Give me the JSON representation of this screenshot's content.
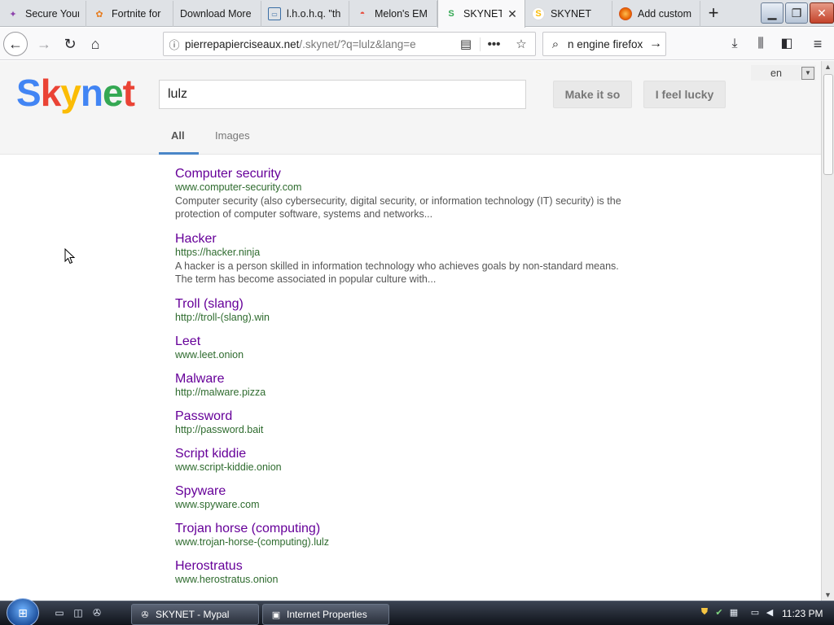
{
  "browser": {
    "tabs": [
      {
        "title": "Secure Your",
        "favicon": "star-icon",
        "favicon_color": "#8e44ad",
        "active": false
      },
      {
        "title": "Fortnite for",
        "favicon": "puzzle-icon",
        "favicon_color": "#e67e22",
        "active": false
      },
      {
        "title": "Download More",
        "favicon": "",
        "favicon_color": "",
        "active": false
      },
      {
        "title": "l.h.o.h.q. \"th",
        "favicon": "",
        "favicon_color": "",
        "active": false
      },
      {
        "title": "Melon's EM",
        "favicon": "watermelon-icon",
        "favicon_color": "#e74c3c",
        "active": false
      },
      {
        "title": "SKYNET",
        "favicon": "dollar-s-icon",
        "favicon_color": "#34a853",
        "active": true
      },
      {
        "title": "SKYNET",
        "favicon": "dollar-s-icon",
        "favicon_color": "#fbbc05",
        "active": false
      },
      {
        "title": "Add custom",
        "favicon": "firefox-icon",
        "favicon_color": "#e66000",
        "active": false
      }
    ],
    "url": {
      "host": "pierrepapierciseaux.net",
      "path": "/.skynet/?q=lulz&lang=e"
    },
    "search_text": "n engine firefox"
  },
  "page": {
    "logo": [
      "S",
      "k",
      "y",
      "n",
      "e",
      "t"
    ],
    "query": "lulz",
    "make_it_so": "Make it so",
    "feel_lucky": "I feel lucky",
    "lang": "en",
    "tabs": [
      "All",
      "Images"
    ],
    "results": [
      {
        "title": "Computer security",
        "url": "www.computer-security.com",
        "desc": "Computer security (also cybersecurity, digital security, or information technology (IT) security) is the protection of computer software, systems and networks..."
      },
      {
        "title": "Hacker",
        "url": "https://hacker.ninja",
        "desc": "A hacker is a person skilled in information technology who achieves goals by non-standard means. The term has become associated in popular culture with..."
      },
      {
        "title": "Troll (slang)",
        "url": "http://troll-(slang).win",
        "desc": ""
      },
      {
        "title": "Leet",
        "url": "www.leet.onion",
        "desc": ""
      },
      {
        "title": "Malware",
        "url": "http://malware.pizza",
        "desc": ""
      },
      {
        "title": "Password",
        "url": "http://password.bait",
        "desc": ""
      },
      {
        "title": "Script kiddie",
        "url": "www.script-kiddie.onion",
        "desc": ""
      },
      {
        "title": "Spyware",
        "url": "www.spyware.com",
        "desc": ""
      },
      {
        "title": "Trojan horse (computing)",
        "url": "www.trojan-horse-(computing).lulz",
        "desc": ""
      },
      {
        "title": "Herostratus",
        "url": "www.herostratus.onion",
        "desc": ""
      }
    ]
  },
  "taskbar": {
    "windows": [
      "SKYNET - Mypal",
      "Internet Properties"
    ],
    "clock": "11:23 PM"
  }
}
